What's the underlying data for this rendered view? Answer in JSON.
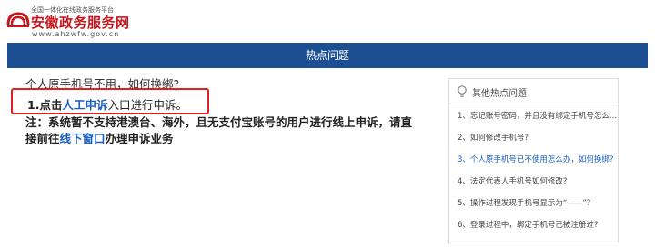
{
  "header": {
    "logo_subtitle": "全国一体化在线政务服务平台",
    "logo_title": "安徽政务服务网",
    "logo_url": "www.ahzwfw.gov.cn"
  },
  "section_bar": {
    "title": "热点问题"
  },
  "main": {
    "question": "个人原手机号不用，如何换绑?",
    "step_prefix": "1.点击",
    "step_link": "人工申诉",
    "step_suffix": "入口进行申诉。",
    "note_prefix": "注：系统暂不支持港澳台、海外，且无支付宝账号的用户进行线上申诉，请直接前往",
    "note_link": "线下窗口",
    "note_suffix": "办理申诉业务"
  },
  "sidebar": {
    "title": "其他热点问题",
    "items": [
      {
        "label": "1、忘记账号密码，并且没有绑定手机号怎么..."
      },
      {
        "label": "2、如何修改手机号?"
      },
      {
        "label": "3、个人原手机号已不使用怎么办，如何换绑?"
      },
      {
        "label": "4、法定代表人手机号如何修改?"
      },
      {
        "label": "5、操作过程发现手机号显示为“——”？"
      },
      {
        "label": "6、登录过程中，绑定手机号已被注册过?"
      }
    ]
  },
  "colors": {
    "brand_red": "#c8161d",
    "nav_blue": "#1c4f91",
    "link_blue": "#1a5fc4",
    "highlight_red": "#e02020"
  },
  "icons": {
    "logo": "anhui-logo-icon",
    "sidebar": "lightbulb-icon"
  }
}
